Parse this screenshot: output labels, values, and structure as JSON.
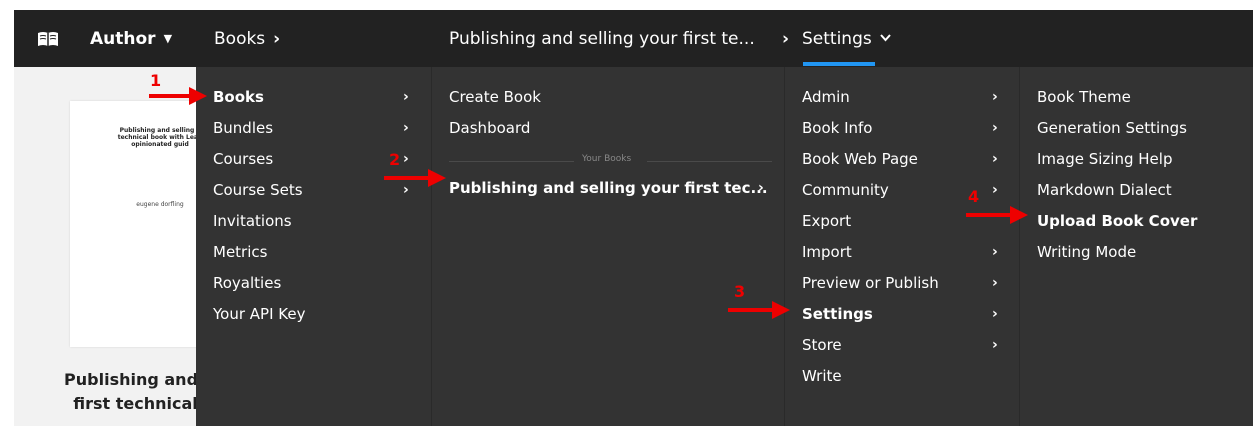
{
  "topbar": {
    "logo_icon": "open-book-icon",
    "author_label": "Author",
    "books_label": "Books",
    "breadcrumb": "Publishing and selling your first te...",
    "separator": "›",
    "settings_label": "Settings",
    "accent_color": "#2196f3"
  },
  "book_card": {
    "cover_title": "Publishing and selling y\ntechnical book with Lean\nopinionated guid",
    "cover_author": "eugene dorfling",
    "name_line1": "Publishing and se",
    "name_line2": "first technical b"
  },
  "menu1": {
    "items": [
      {
        "label": "Books",
        "bold": true
      },
      {
        "label": "Bundles"
      },
      {
        "label": "Courses"
      },
      {
        "label": "Course Sets"
      },
      {
        "label": "Invitations"
      },
      {
        "label": "Metrics"
      },
      {
        "label": "Royalties"
      },
      {
        "label": "Your API Key"
      }
    ]
  },
  "menu2": {
    "create_book": "Create Book",
    "dashboard": "Dashboard",
    "group_label": "Your Books",
    "book_item": "Publishing and selling your first tec..."
  },
  "menu3": {
    "items": [
      {
        "label": "Admin"
      },
      {
        "label": "Book Info"
      },
      {
        "label": "Book Web Page"
      },
      {
        "label": "Community"
      },
      {
        "label": "Export"
      },
      {
        "label": "Import"
      },
      {
        "label": "Preview or Publish"
      },
      {
        "label": "Settings",
        "bold": true
      },
      {
        "label": "Store"
      },
      {
        "label": "Write"
      }
    ]
  },
  "menu4": {
    "items": [
      {
        "label": "Book Theme"
      },
      {
        "label": "Generation Settings"
      },
      {
        "label": "Image Sizing Help"
      },
      {
        "label": "Markdown Dialect"
      },
      {
        "label": "Upload Book Cover",
        "bold": true
      },
      {
        "label": "Writing Mode"
      }
    ]
  },
  "annotations": {
    "step1": "1",
    "step2": "2",
    "step3": "3",
    "step4": "4",
    "color": "#e00000"
  },
  "chevron_glyph": "›"
}
